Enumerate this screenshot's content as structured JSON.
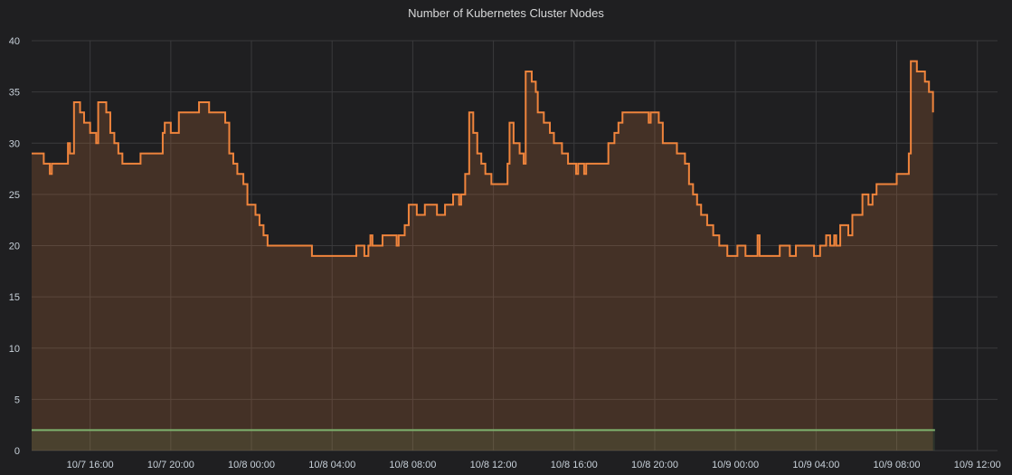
{
  "chart_data": {
    "type": "line",
    "title": "Number of Kubernetes Cluster Nodes",
    "xlabel": "",
    "ylabel": "",
    "x_unit": "hours since 10/7 00:00",
    "x_range": [
      13.1,
      61
    ],
    "xticks": [
      {
        "x": 16,
        "label": "10/7 16:00"
      },
      {
        "x": 20,
        "label": "10/7 20:00"
      },
      {
        "x": 24,
        "label": "10/8 00:00"
      },
      {
        "x": 28,
        "label": "10/8 04:00"
      },
      {
        "x": 32,
        "label": "10/8 08:00"
      },
      {
        "x": 36,
        "label": "10/8 12:00"
      },
      {
        "x": 40,
        "label": "10/8 16:00"
      },
      {
        "x": 44,
        "label": "10/8 20:00"
      },
      {
        "x": 48,
        "label": "10/9 00:00"
      },
      {
        "x": 52,
        "label": "10/9 04:00"
      },
      {
        "x": 56,
        "label": "10/9 08:00"
      },
      {
        "x": 60,
        "label": "10/9 12:00"
      }
    ],
    "ylim": [
      0,
      40
    ],
    "yticks": [
      0,
      5,
      10,
      15,
      20,
      25,
      30,
      35,
      40
    ],
    "grid": true,
    "series": [
      {
        "color": "#ef843c",
        "fill": true,
        "step": true,
        "points": [
          [
            13.1,
            29
          ],
          [
            13.7,
            28
          ],
          [
            14.0,
            27
          ],
          [
            14.1,
            28
          ],
          [
            14.4,
            28
          ],
          [
            14.9,
            30
          ],
          [
            15.0,
            29
          ],
          [
            15.2,
            34
          ],
          [
            15.5,
            33
          ],
          [
            15.7,
            32
          ],
          [
            16.0,
            31
          ],
          [
            16.3,
            30
          ],
          [
            16.4,
            34
          ],
          [
            16.8,
            33
          ],
          [
            17.0,
            31
          ],
          [
            17.2,
            30
          ],
          [
            17.4,
            29
          ],
          [
            17.6,
            28
          ],
          [
            18.5,
            29
          ],
          [
            19.6,
            31
          ],
          [
            19.7,
            32
          ],
          [
            20.0,
            31
          ],
          [
            20.4,
            33
          ],
          [
            21.4,
            34
          ],
          [
            21.9,
            33
          ],
          [
            22.7,
            32
          ],
          [
            22.9,
            29
          ],
          [
            23.1,
            28
          ],
          [
            23.3,
            27
          ],
          [
            23.6,
            26
          ],
          [
            23.8,
            24
          ],
          [
            24.2,
            23
          ],
          [
            24.4,
            22
          ],
          [
            24.6,
            21
          ],
          [
            24.8,
            20
          ],
          [
            27.0,
            19
          ],
          [
            29.2,
            20
          ],
          [
            29.6,
            19
          ],
          [
            29.8,
            20
          ],
          [
            29.9,
            21
          ],
          [
            30.0,
            20
          ],
          [
            30.5,
            21
          ],
          [
            31.2,
            20
          ],
          [
            31.3,
            21
          ],
          [
            31.6,
            22
          ],
          [
            31.8,
            24
          ],
          [
            32.2,
            23
          ],
          [
            32.6,
            24
          ],
          [
            33.2,
            23
          ],
          [
            33.6,
            24
          ],
          [
            34.0,
            25
          ],
          [
            34.3,
            24
          ],
          [
            34.4,
            25
          ],
          [
            34.6,
            27
          ],
          [
            34.8,
            33
          ],
          [
            35.0,
            31
          ],
          [
            35.2,
            29
          ],
          [
            35.4,
            28
          ],
          [
            35.6,
            27
          ],
          [
            35.9,
            26
          ],
          [
            36.7,
            28
          ],
          [
            36.8,
            32
          ],
          [
            37.0,
            30
          ],
          [
            37.3,
            29
          ],
          [
            37.5,
            28
          ],
          [
            37.6,
            37
          ],
          [
            37.9,
            36
          ],
          [
            38.1,
            35
          ],
          [
            38.2,
            33
          ],
          [
            38.5,
            32
          ],
          [
            38.8,
            31
          ],
          [
            39.0,
            30
          ],
          [
            39.4,
            29
          ],
          [
            39.7,
            28
          ],
          [
            40.1,
            27
          ],
          [
            40.2,
            28
          ],
          [
            40.5,
            27
          ],
          [
            40.6,
            28
          ],
          [
            41.7,
            30
          ],
          [
            42.0,
            31
          ],
          [
            42.2,
            32
          ],
          [
            42.4,
            33
          ],
          [
            43.7,
            32
          ],
          [
            43.8,
            33
          ],
          [
            44.2,
            32
          ],
          [
            44.4,
            30
          ],
          [
            45.1,
            29
          ],
          [
            45.5,
            28
          ],
          [
            45.7,
            26
          ],
          [
            45.9,
            25
          ],
          [
            46.1,
            24
          ],
          [
            46.3,
            23
          ],
          [
            46.6,
            22
          ],
          [
            46.9,
            21
          ],
          [
            47.2,
            20
          ],
          [
            47.6,
            19
          ],
          [
            48.1,
            20
          ],
          [
            48.5,
            19
          ],
          [
            49.1,
            21
          ],
          [
            49.2,
            19
          ],
          [
            50.2,
            20
          ],
          [
            50.7,
            19
          ],
          [
            51.0,
            20
          ],
          [
            51.5,
            20
          ],
          [
            51.9,
            19
          ],
          [
            52.2,
            20
          ],
          [
            52.5,
            21
          ],
          [
            52.7,
            20
          ],
          [
            52.9,
            21
          ],
          [
            53.0,
            20
          ],
          [
            53.2,
            22
          ],
          [
            53.6,
            21
          ],
          [
            53.8,
            23
          ],
          [
            54.3,
            25
          ],
          [
            54.6,
            24
          ],
          [
            54.8,
            25
          ],
          [
            55.0,
            26
          ],
          [
            56.0,
            27
          ],
          [
            56.6,
            29
          ],
          [
            56.7,
            38
          ],
          [
            57.0,
            37
          ],
          [
            57.4,
            36
          ],
          [
            57.6,
            35
          ],
          [
            57.8,
            33
          ]
        ]
      },
      {
        "color": "#7eb26d",
        "fill": true,
        "step": true,
        "points": [
          [
            13.1,
            2
          ],
          [
            57.9,
            2
          ]
        ]
      }
    ]
  }
}
